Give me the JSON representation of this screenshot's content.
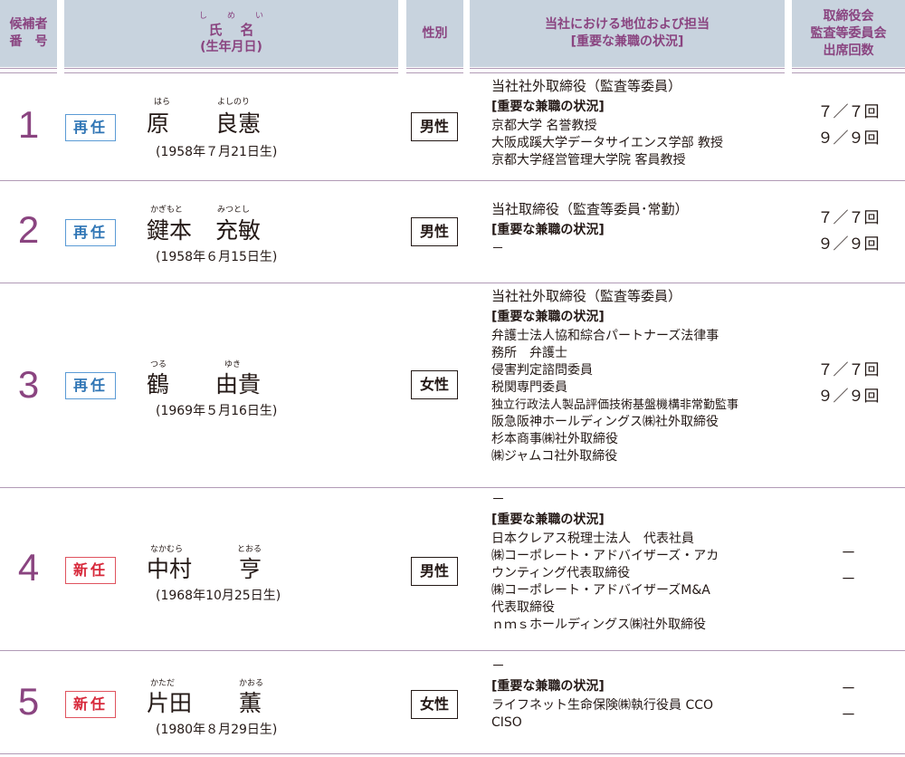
{
  "header": {
    "number_line1": "候補者",
    "number_line2": "番　号",
    "name_ruby": "しめい",
    "name_title": "氏名",
    "name_sub": "(生年月日)",
    "sex": "性別",
    "position_line1": "当社における地位および担当",
    "position_line2": "[重要な兼職の状況]",
    "attendance_line1": "取締役会",
    "attendance_line2": "監査等委員会",
    "attendance_line3": "出席回数"
  },
  "candidates": [
    {
      "number": "1",
      "status": "再任",
      "surname_ruby": "はら",
      "given_ruby": "よしのり",
      "surname": "原",
      "given": "良憲",
      "birth": "(1958年７月21日生)",
      "sex": "男性",
      "title": "当社社外取締役（監査等委員）",
      "concurrent_label": "[重要な兼職の状況]",
      "items": [
        "京都大学 名誉教授",
        "大阪成蹊大学データサイエンス学部 教授",
        "京都大学経営管理大学院 客員教授"
      ],
      "board": "７／７回",
      "audit": "９／９回"
    },
    {
      "number": "2",
      "status": "再任",
      "surname_ruby": "かぎもと",
      "given_ruby": "みつとし",
      "surname": "鍵本",
      "given": "充敏",
      "birth": "(1958年６月15日生)",
      "sex": "男性",
      "title": "当社取締役（監査等委員･常勤）",
      "concurrent_label": "[重要な兼職の状況]",
      "items": [
        "－"
      ],
      "board": "７／７回",
      "audit": "９／９回"
    },
    {
      "number": "3",
      "status": "再任",
      "surname_ruby": "つる",
      "given_ruby": "ゆき",
      "surname": "鶴",
      "given": "由貴",
      "birth": "(1969年５月16日生)",
      "sex": "女性",
      "title": "当社社外取締役（監査等委員）",
      "concurrent_label": "[重要な兼職の状況]",
      "items": [
        "弁護士法人協和綜合パートナーズ法律事",
        "務所　弁護士",
        "侵害判定諮問委員",
        "税関専門委員",
        "独立行政法人製品評価技術基盤機構非常勤監事",
        "阪急阪神ホールディングス㈱社外取締役",
        "杉本商事㈱社外取締役",
        "㈱ジャムコ社外取締役"
      ],
      "board": "７／７回",
      "audit": "９／９回"
    },
    {
      "number": "4",
      "status": "新任",
      "surname_ruby": "なかむら",
      "given_ruby": "とおる",
      "surname": "中村",
      "given": "亨",
      "birth": "(1968年10月25日生)",
      "sex": "男性",
      "title": "－",
      "concurrent_label": "[重要な兼職の状況]",
      "items": [
        "日本クレアス税理士法人　代表社員",
        "㈱コーポレート・アドバイザーズ・アカ",
        "ウンティング代表取締役",
        "㈱コーポレート・アドバイザーズM&A",
        "代表取締役",
        "ｎｍｓホールディングス㈱社外取締役"
      ],
      "board": "－",
      "audit": "－"
    },
    {
      "number": "5",
      "status": "新任",
      "surname_ruby": "かただ",
      "given_ruby": "かおる",
      "surname": "片田",
      "given": "薫",
      "birth": "(1980年８月29日生)",
      "sex": "女性",
      "title": "－",
      "concurrent_label": "[重要な兼職の状況]",
      "items": [
        "ライフネット生命保険㈱執行役員 CCO",
        "CISO"
      ],
      "board": "－",
      "audit": "－"
    }
  ],
  "colors": {
    "header_bg": "#c8d3de",
    "accent_purple": "#8a4480",
    "reappoint_blue": "#2f75b5",
    "new_red": "#d7283a"
  }
}
